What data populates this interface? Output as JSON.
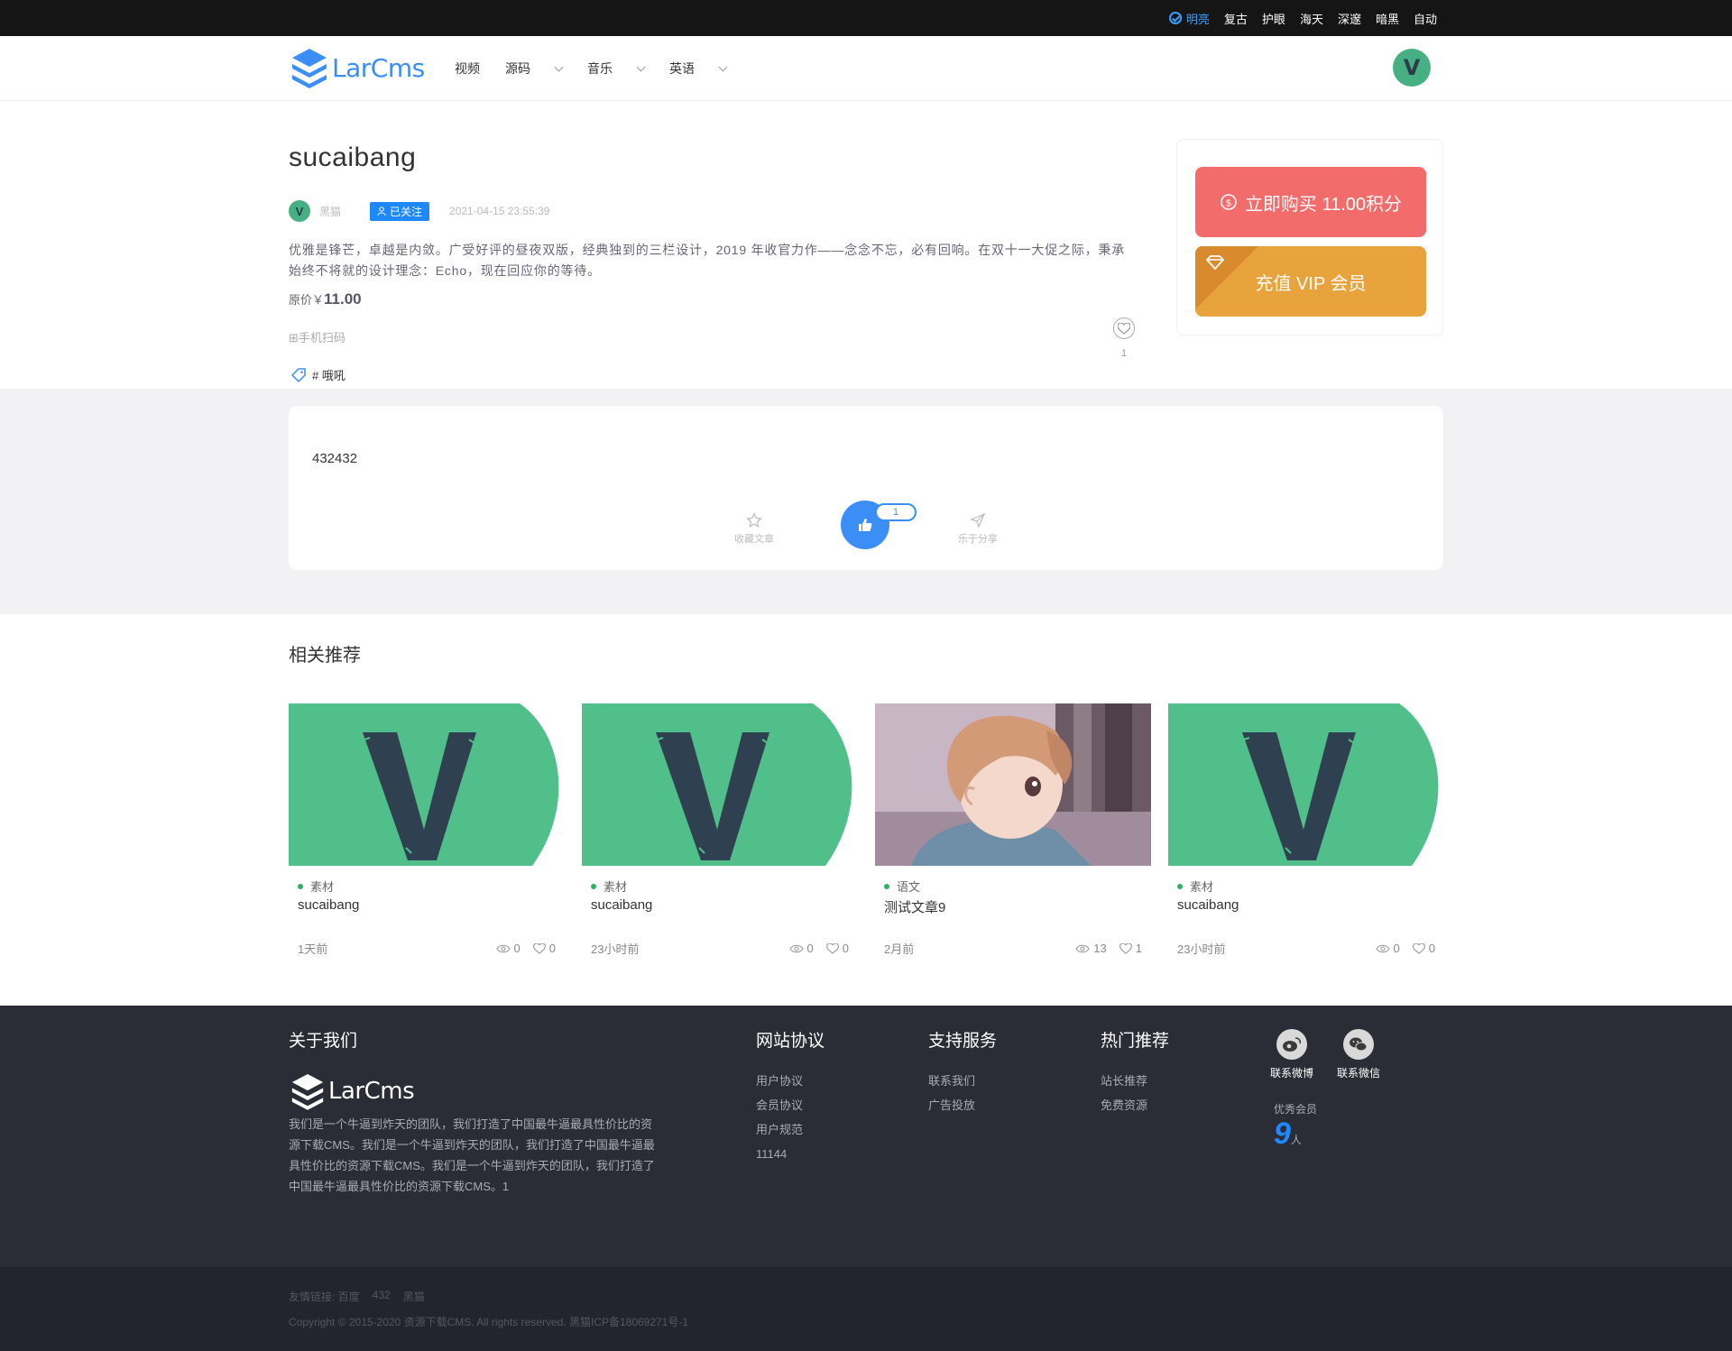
{
  "theme_bar": {
    "items": [
      "明亮",
      "复古",
      "护眼",
      "海天",
      "深邃",
      "暗黑",
      "自动"
    ],
    "active": "明亮"
  },
  "header": {
    "logo_text": "LarCms",
    "nav": [
      {
        "label": "视频",
        "has_dropdown": false
      },
      {
        "label": "源码",
        "has_dropdown": true
      },
      {
        "label": "音乐",
        "has_dropdown": true
      },
      {
        "label": "英语",
        "has_dropdown": true
      }
    ],
    "avatar_letter": "V"
  },
  "article": {
    "title": "sucaibang",
    "author": "黑猫",
    "author_avatar_letter": "V",
    "follow_label": "已关注",
    "date": "2021-04-15 23:55:39",
    "description": "优雅是锋芒，卓越是内敛。广受好评的昼夜双版，经典独到的三栏设计，2019 年收官力作——念念不忘，必有回响。在双十一大促之际，秉承始终不将就的设计理念：Echo，现在回应你的等待。",
    "price_label": "原价￥",
    "price_value": "11.00",
    "scan_label": "⊞手机扫码",
    "tag": "# 哦吼",
    "like_count": "1"
  },
  "buy_card": {
    "buy_label": "立即购买 11.00积分",
    "vip_label": "充值 VIP 会员"
  },
  "content": {
    "body": "432432",
    "favorite_label": "收藏文章",
    "share_label": "乐于分享",
    "thumb_count": "1"
  },
  "related": {
    "title": "相关推荐",
    "items": [
      {
        "category": "素材",
        "name": "sucaibang",
        "time": "1天前",
        "views": "0",
        "likes": "0",
        "image": "v-logo"
      },
      {
        "category": "素材",
        "name": "sucaibang",
        "time": "23小时前",
        "views": "0",
        "likes": "0",
        "image": "v-logo"
      },
      {
        "category": "语文",
        "name": "测试文章9",
        "time": "2月前",
        "views": "13",
        "likes": "1",
        "image": "anime"
      },
      {
        "category": "素材",
        "name": "sucaibang",
        "time": "23小时前",
        "views": "0",
        "likes": "0",
        "image": "v-logo"
      }
    ]
  },
  "footer": {
    "about_title": "关于我们",
    "logo_text": "LarCms",
    "about_desc": "我们是一个牛逼到炸天的团队，我们打造了中国最牛逼最具性价比的资源下载CMS。我们是一个牛逼到炸天的团队，我们打造了中国最牛逼最具性价比的资源下载CMS。我们是一个牛逼到炸天的团队，我们打造了中国最牛逼最具性价比的资源下载CMS。1",
    "protocol": {
      "title": "网站协议",
      "links": [
        "用户协议",
        "会员协议",
        "用户规范",
        "11144"
      ]
    },
    "support": {
      "title": "支持服务",
      "links": [
        "联系我们",
        "广告投放"
      ]
    },
    "hot": {
      "title": "热门推荐",
      "links": [
        "站长推荐",
        "免费资源"
      ]
    },
    "weibo_label": "联系微博",
    "wechat_label": "联系微信",
    "members_label": "优秀会员",
    "members_count": "9",
    "members_unit": "人",
    "friend_links": [
      "友情链接: 百度",
      "432",
      "黑猫"
    ],
    "copyright": "Copyright © 2015-2020 资源下载CMS. All rights reserved. 黑猫ICP备18069271号-1"
  },
  "colors": {
    "accent": "#3a8ef6",
    "buy": "#f36c6c",
    "vip": "#e8a33c",
    "vlogo": "#50bf8a",
    "footer": "#2a2c36"
  }
}
